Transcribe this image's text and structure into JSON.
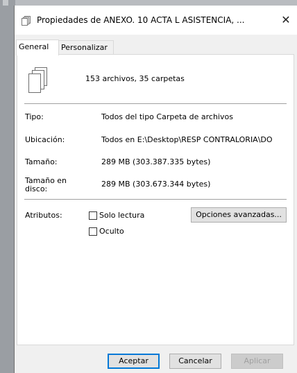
{
  "window": {
    "title": "Propiedades de ANEXO. 10 ACTA L ASISTENCIA, ...",
    "close_glyph": "✕"
  },
  "tabs": [
    "General",
    "Personalizar"
  ],
  "summary": "153 archivos, 35 carpetas",
  "properties": [
    {
      "label": "Tipo:",
      "value": "Todos del tipo Carpeta de archivos"
    },
    {
      "label": "Ubicación:",
      "value": "Todos en E:\\Desktop\\RESP CONTRALORIA\\DO"
    },
    {
      "label": "Tamaño:",
      "value": "289 MB (303.387.335 bytes)"
    },
    {
      "label": "Tamaño en disco:",
      "value": "289 MB (303.673.344 bytes)"
    }
  ],
  "attributes": {
    "label": "Atributos:",
    "read_only": "Solo lectura",
    "hidden": "Oculto",
    "advanced_button": "Opciones avanzadas..."
  },
  "buttons": {
    "ok": "Aceptar",
    "cancel": "Cancelar",
    "apply": "Aplicar"
  }
}
